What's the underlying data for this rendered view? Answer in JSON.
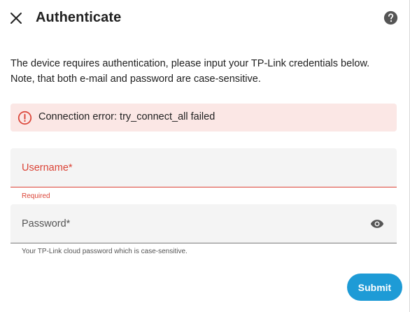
{
  "dialog": {
    "title": "Authenticate",
    "description_line1": "The device requires authentication, please input your TP-Link credentials below.",
    "description_line2": "Note, that both e-mail and password are case-sensitive."
  },
  "alert": {
    "icon": "alert-circle-icon",
    "message": "Connection error: try_connect_all failed",
    "color": "#db4437",
    "background": "#fbe7e5"
  },
  "form": {
    "username": {
      "label": "Username*",
      "value": "",
      "error_text": "Required"
    },
    "password": {
      "label": "Password*",
      "value": "",
      "helper_text": "Your TP-Link cloud password which is case-sensitive."
    }
  },
  "actions": {
    "submit_label": "Submit",
    "accent_color": "#1e9bd6"
  },
  "icons": {
    "close": "close-icon",
    "help": "help-circle-icon",
    "visibility": "eye-icon"
  }
}
